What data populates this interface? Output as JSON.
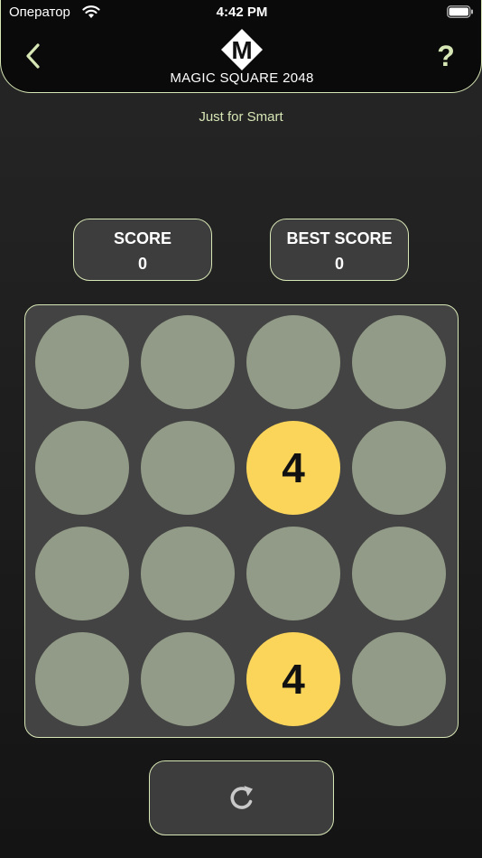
{
  "status_bar": {
    "carrier": "Оператор",
    "time": "4:42 PM"
  },
  "header": {
    "logo_letter": "M",
    "title": "MAGIC SQUARE 2048",
    "help_label": "?"
  },
  "tagline": "Just for Smart",
  "scores": {
    "score": {
      "label": "SCORE",
      "value": "0"
    },
    "best": {
      "label": "BEST SCORE",
      "value": "0"
    }
  },
  "board": {
    "size": 4,
    "tiles": [
      {
        "row": 1,
        "col": 2,
        "value": "4"
      },
      {
        "row": 3,
        "col": 2,
        "value": "4"
      }
    ]
  },
  "colors": {
    "accent": "#d6e6b5",
    "empty_cell": "#929b87",
    "tile_4": "#fad55a",
    "panel": "#3d3d3d"
  },
  "icons": {
    "back": "chevron-left-icon",
    "help": "question-icon",
    "restart": "refresh-icon"
  }
}
